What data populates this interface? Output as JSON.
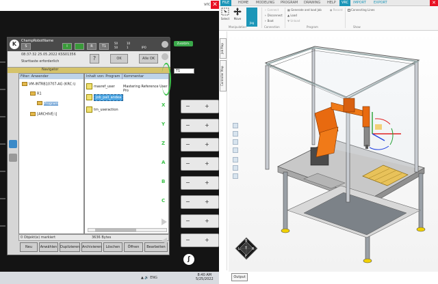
{
  "left_window": {
    "title_short": "vrc",
    "close_glyph": "✕"
  },
  "smartpad": {
    "robot_name": "ChampRobotName",
    "status": {
      "s_label": "S",
      "i_label": "I",
      "r_label": "R",
      "t1_label": "T1",
      "speed_top": "50",
      "speed_bottom": "50",
      "mode_top": "10",
      "mode_bottom": "1",
      "ipo": "IPO"
    },
    "message": {
      "time": "08:37:32 25.05.2022 KSS01356",
      "text": "Starttaste erforderlich",
      "help_btn": "?",
      "ok_btn": "OK",
      "all_ok_btn": "Alle OK"
    },
    "navigator_label": "Navigator",
    "filter_label": "Filter: Anwender",
    "tree": [
      {
        "label": "VM-INTRB10707-AG (KRC:\\)"
      },
      {
        "label": "R1"
      },
      {
        "label": "Program"
      },
      {
        "label": "[ARCHIVE:\\]"
      }
    ],
    "files_header": {
      "name": "Inhalt von: Program",
      "comment": "Kommentar"
    },
    "files": [
      {
        "name": "masref_user",
        "comment": "Mastering Reference User Pro"
      },
      {
        "name": "job_pall_andea"
      },
      {
        "name": "tm_useraction"
      }
    ],
    "status_left": "0 Objekt(e) markiert",
    "status_right": "3636 Bytes",
    "softkeys": [
      "Neu",
      "Anwählen",
      "Duplizieren",
      "Archivieren",
      "Löschen",
      "Öffnen",
      "Bearbeiten"
    ]
  },
  "right_rail": {
    "zusatz": "Zusatzm.",
    "t1_select": "T1",
    "axes": [
      "X",
      "Y",
      "Z",
      "A",
      "B",
      "C"
    ],
    "minus": "−",
    "plus": "+",
    "kuka_glyph": "ʃ"
  },
  "taskbar": {
    "tray": "▲ 🔊 ENG",
    "time": "8:40 AM",
    "date": "5/25/2022"
  },
  "vc": {
    "tabs": [
      "FILE",
      "HOME",
      "MODELING",
      "PROGRAM",
      "DRAWING",
      "HELP",
      "VRC",
      "IMPORT",
      "EXPORT"
    ],
    "ribbon": {
      "select": "Select",
      "move": "Move",
      "jog": "Jog",
      "connect": "Connect",
      "disconnect": "Disconnect",
      "boot": "Boot",
      "generate": "Generate and load Job",
      "load": "Load",
      "unload": "Unload",
      "record": "Record",
      "connecting_lines": "Connecting Lines",
      "groups": [
        "Manipulation",
        "Connection",
        "Program",
        "Show"
      ]
    },
    "vtabs": [
      "Job Map",
      "Controller Map"
    ],
    "navcube": {
      "b": "B",
      "l": "L",
      "t": "T",
      "r": "R",
      "f": "F"
    },
    "output": "Output",
    "close_glyph": "✕"
  }
}
